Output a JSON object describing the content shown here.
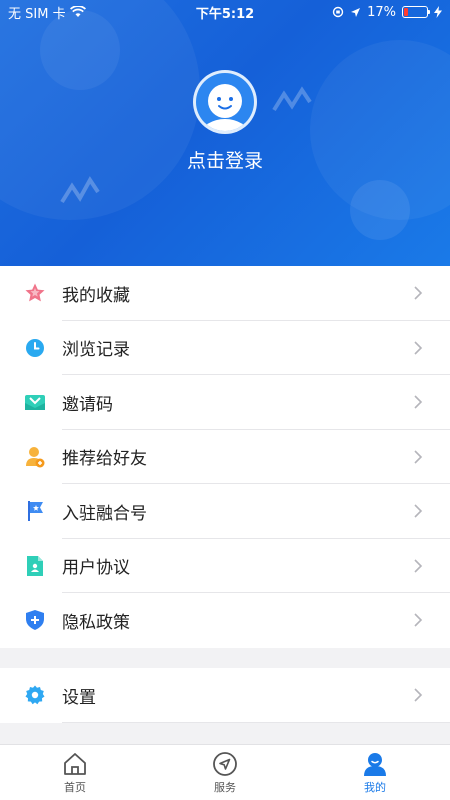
{
  "status_bar": {
    "carrier": "无 SIM 卡",
    "time": "下午5:12",
    "battery": "17%"
  },
  "profile": {
    "login_label": "点击登录"
  },
  "menu": {
    "items": [
      {
        "label": "我的收藏",
        "icon": "star-icon"
      },
      {
        "label": "浏览记录",
        "icon": "clock-icon"
      },
      {
        "label": "邀请码",
        "icon": "envelope-icon"
      },
      {
        "label": "推荐给好友",
        "icon": "add-user-icon"
      },
      {
        "label": "入驻融合号",
        "icon": "flag-icon"
      },
      {
        "label": "用户协议",
        "icon": "document-icon"
      },
      {
        "label": "隐私政策",
        "icon": "shield-icon"
      }
    ],
    "settings_label": "设置"
  },
  "tabbar": {
    "tabs": [
      {
        "label": "首页",
        "icon": "home-icon"
      },
      {
        "label": "服务",
        "icon": "navigation-icon"
      },
      {
        "label": "我的",
        "icon": "user-icon"
      }
    ],
    "active_index": 2
  },
  "colors": {
    "header_blue": "#1a6ee6",
    "accent": "#1a7ae8",
    "battery_low": "#ff3b30"
  }
}
